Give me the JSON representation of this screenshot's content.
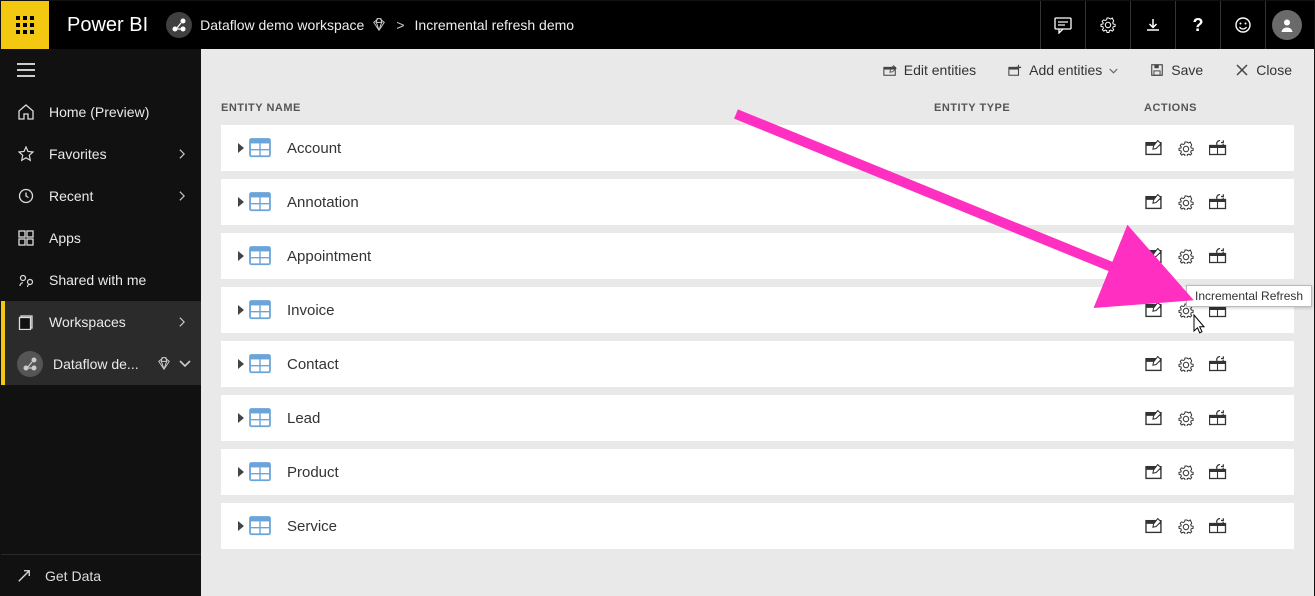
{
  "header": {
    "brand": "Power BI",
    "workspace": "Dataflow demo workspace",
    "page": "Incremental refresh demo"
  },
  "sidebar": {
    "items": [
      {
        "icon": "home",
        "label": "Home (Preview)",
        "chev": false
      },
      {
        "icon": "star",
        "label": "Favorites",
        "chev": true
      },
      {
        "icon": "clock",
        "label": "Recent",
        "chev": true
      },
      {
        "icon": "apps",
        "label": "Apps",
        "chev": false
      },
      {
        "icon": "share",
        "label": "Shared with me",
        "chev": false
      },
      {
        "icon": "book",
        "label": "Workspaces",
        "chev": true
      }
    ],
    "active_workspace": "Dataflow de...",
    "get_data": "Get Data"
  },
  "toolbar": {
    "edit": "Edit entities",
    "add": "Add entities",
    "save": "Save",
    "close": "Close"
  },
  "columns": {
    "name": "ENTITY NAME",
    "type": "ENTITY TYPE",
    "actions": "ACTIONS"
  },
  "entities": [
    {
      "name": "Account"
    },
    {
      "name": "Annotation"
    },
    {
      "name": "Appointment"
    },
    {
      "name": "Invoice"
    },
    {
      "name": "Contact"
    },
    {
      "name": "Lead"
    },
    {
      "name": "Product"
    },
    {
      "name": "Service"
    }
  ],
  "tooltip": "Incremental Refresh"
}
